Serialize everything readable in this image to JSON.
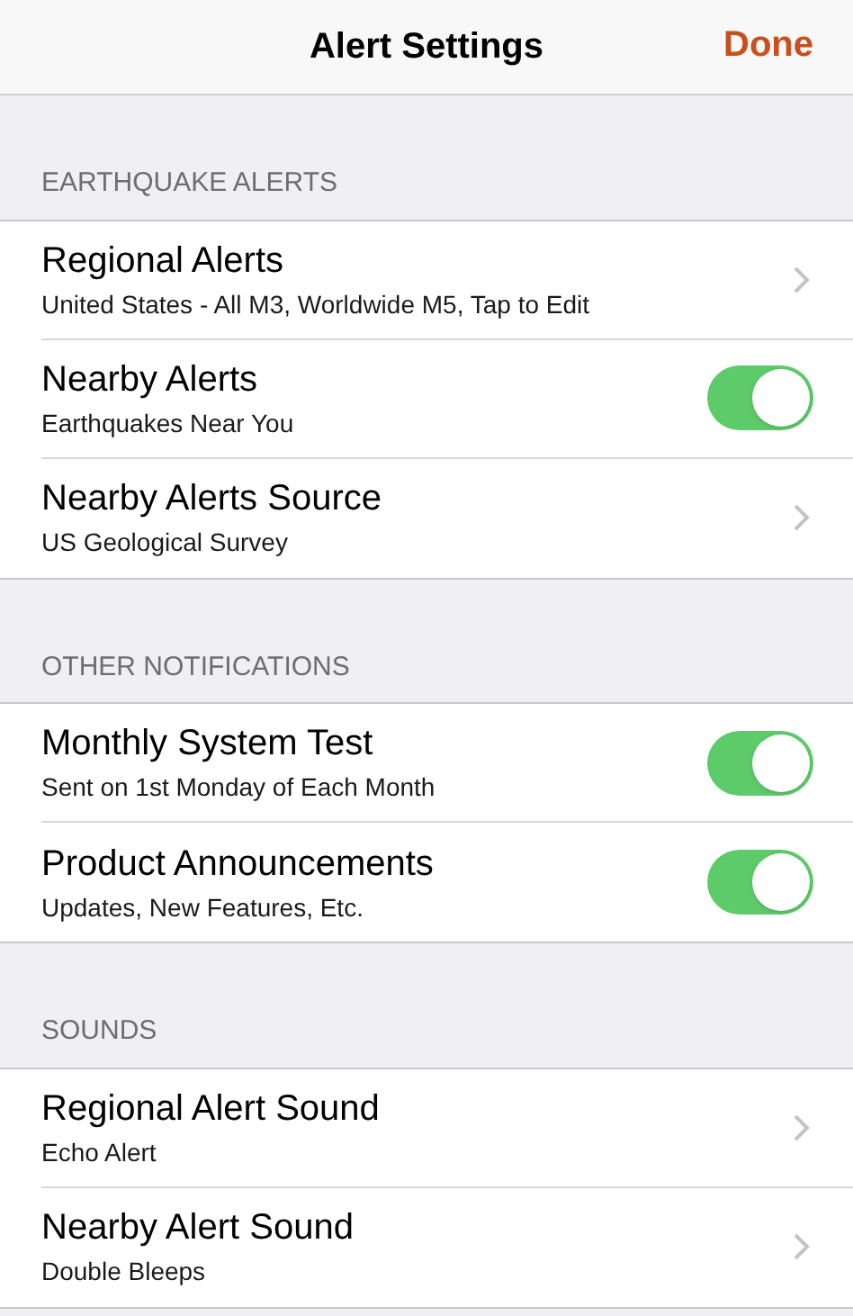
{
  "nav": {
    "title": "Alert Settings",
    "done": "Done"
  },
  "sections": [
    {
      "header": "EARTHQUAKE ALERTS",
      "rows": [
        {
          "kind": "link",
          "title": "Regional Alerts",
          "subtitle": "United States - All M3, Worldwide M5, Tap to Edit"
        },
        {
          "kind": "toggle",
          "title": "Nearby Alerts",
          "subtitle": "Earthquakes Near You",
          "on": true
        },
        {
          "kind": "link",
          "title": "Nearby Alerts Source",
          "subtitle": "US Geological Survey"
        }
      ]
    },
    {
      "header": "OTHER NOTIFICATIONS",
      "rows": [
        {
          "kind": "toggle",
          "title": "Monthly System Test",
          "subtitle": "Sent on 1st Monday of Each Month",
          "on": true
        },
        {
          "kind": "toggle",
          "title": "Product Announcements",
          "subtitle": "Updates, New Features, Etc.",
          "on": true
        }
      ]
    },
    {
      "header": "SOUNDS",
      "rows": [
        {
          "kind": "link",
          "title": "Regional Alert Sound",
          "subtitle": "Echo Alert"
        },
        {
          "kind": "link",
          "title": "Nearby Alert Sound",
          "subtitle": "Double Bleeps"
        }
      ]
    }
  ]
}
